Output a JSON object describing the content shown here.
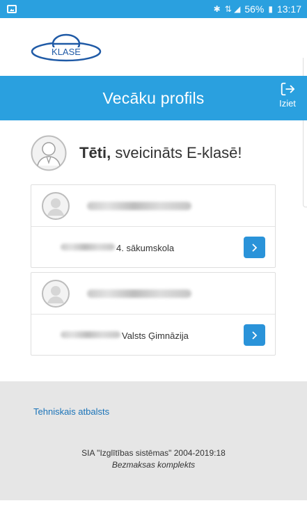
{
  "status_bar": {
    "icons": [
      "gallery-icon",
      "bluetooth-icon",
      "4g-signal-icon",
      "battery-icon"
    ],
    "battery": "56%",
    "time": "13:17",
    "network": "4G"
  },
  "brand": {
    "logo_text": "KLASE",
    "accent_color": "#2aa0df"
  },
  "header": {
    "title": "Vecāku profils",
    "logout_label": "Iziet"
  },
  "greeting": {
    "name": "Tēti,",
    "message": " sveicināts E-klasē!"
  },
  "children": [
    {
      "school": "4. sākumskola"
    },
    {
      "school": "Valsts Ģimnāzija"
    }
  ],
  "footer": {
    "support_link": "Tehniskais atbalsts",
    "copyright": "SIA \"Izglītības sistēmas\" 2004-2019:18",
    "plan": "Bezmaksas komplekts"
  }
}
